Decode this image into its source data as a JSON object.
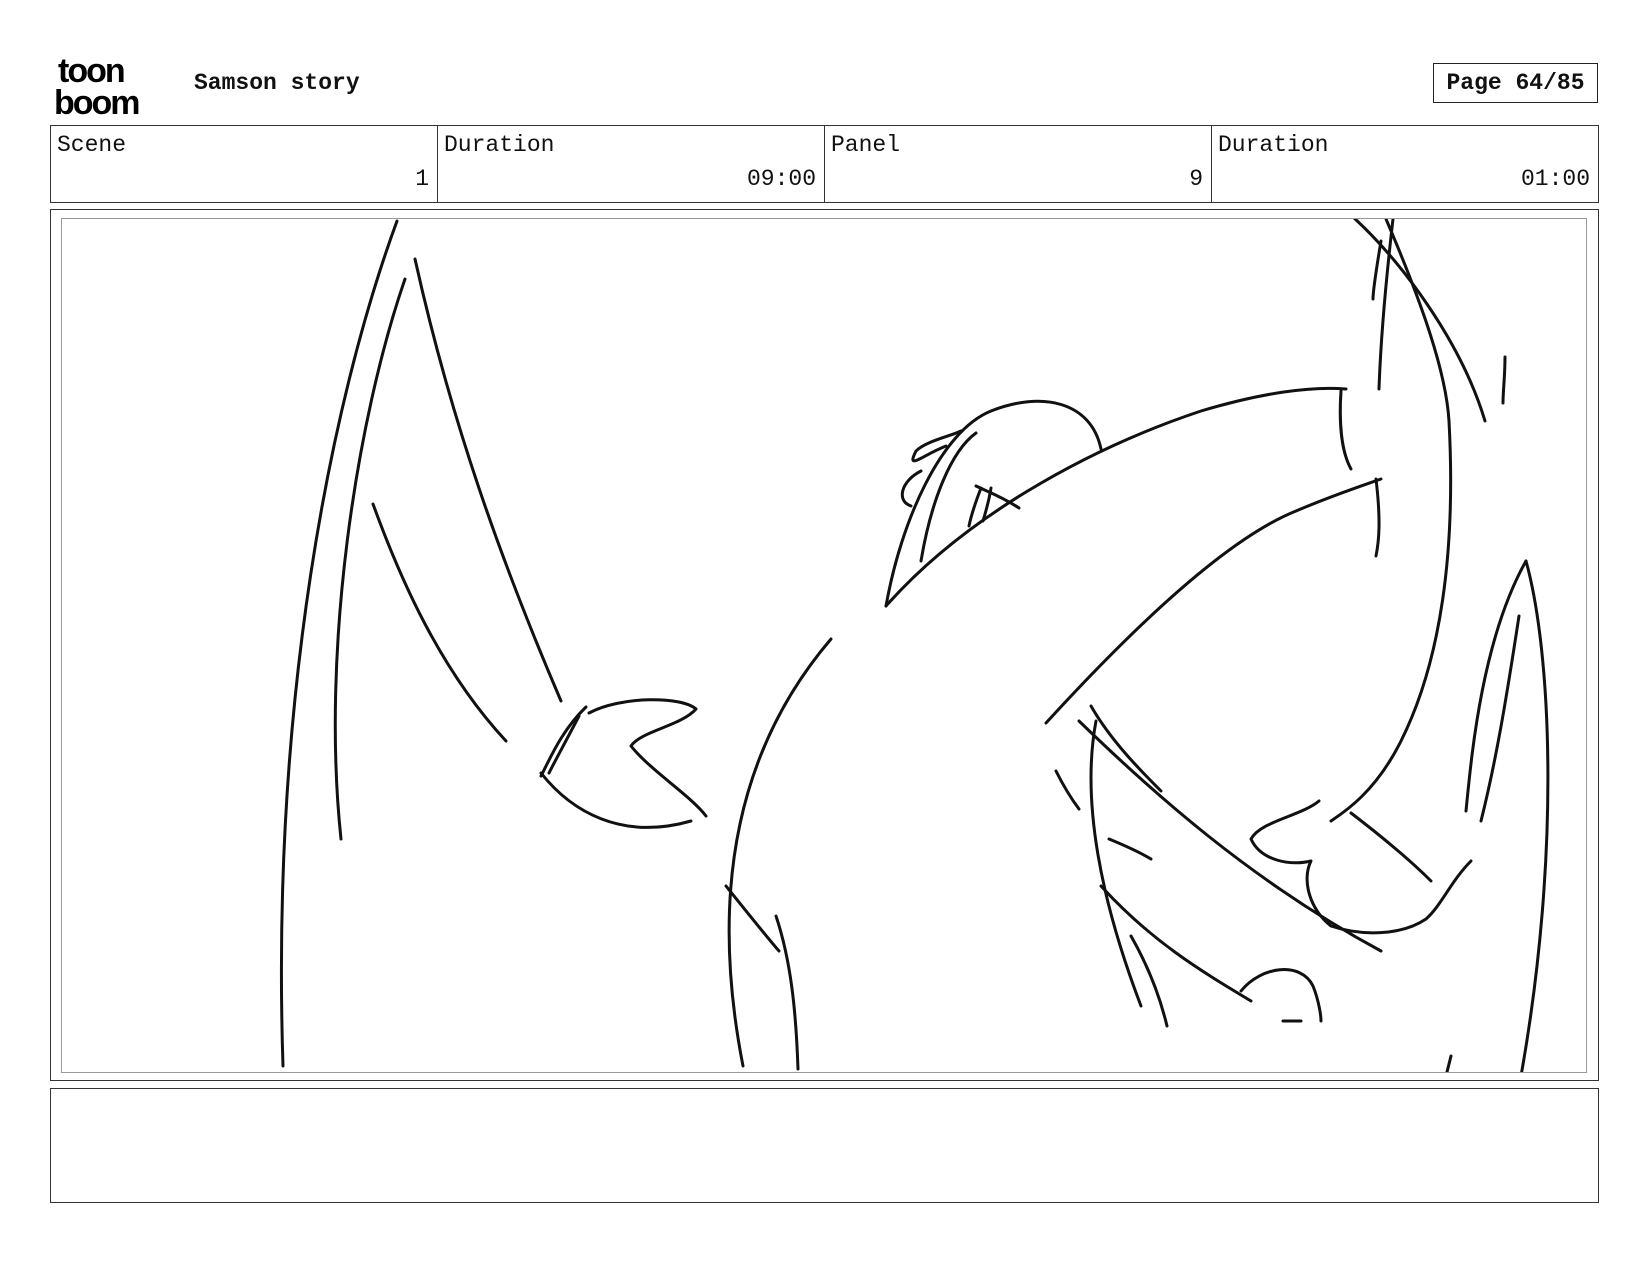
{
  "header": {
    "logo_line1": "toon",
    "logo_line2": "boom",
    "project_title": "Samson story",
    "page_label": "Page 64/85"
  },
  "info": [
    {
      "label": "Scene",
      "value": "1"
    },
    {
      "label": "Duration",
      "value": "09:00"
    },
    {
      "label": "Panel",
      "value": "9"
    },
    {
      "label": "Duration",
      "value": "01:00"
    }
  ],
  "notes": {
    "text": ""
  }
}
